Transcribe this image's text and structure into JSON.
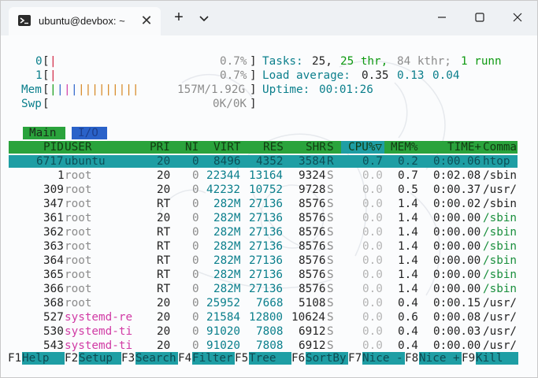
{
  "window": {
    "tab_title": "ubuntu@devbox: ~",
    "tab_icon": "terminal-icon",
    "new_tab_label": "+",
    "close_label": "✕"
  },
  "meters": {
    "cpu0": {
      "label": "0",
      "bar": "|",
      "value": "0.7%"
    },
    "cpu1": {
      "label": "1",
      "bar": "|",
      "value": "0.7%"
    },
    "mem": {
      "label": "Mem",
      "value": "157M/1.92G"
    },
    "swp": {
      "label": "Swp",
      "value": "0K/0K"
    }
  },
  "summary": {
    "tasks_label": "Tasks:",
    "tasks": "25,",
    "threads": "25 thr,",
    "kthr": "84 kthr;",
    "running": "1 runn",
    "load_label": "Load average:",
    "load1": "0.35",
    "load5": "0.13",
    "load15": "0.04",
    "uptime_label": "Uptime:",
    "uptime": "00:01:26"
  },
  "screen_tabs": {
    "main": "Main",
    "io": "I/O"
  },
  "columns": [
    "PID",
    "USER",
    "PRI",
    "NI",
    "VIRT",
    "RES",
    "SHR",
    "S",
    "CPU%▽",
    "MEM%",
    "TIME+",
    "Comma"
  ],
  "processes": [
    {
      "pid": "6717",
      "user": "ubuntu",
      "pri": "20",
      "ni": "0",
      "virt": "8496",
      "res": "4352",
      "shr": "3584",
      "s": "R",
      "cpu": "0.7",
      "mem": "0.2",
      "time": "0:00.06",
      "cmd": "htop"
    },
    {
      "pid": "1",
      "user": "root",
      "pri": "20",
      "ni": "0",
      "virt": "22344",
      "res": "13164",
      "shr": "9324",
      "s": "S",
      "cpu": "0.0",
      "mem": "0.7",
      "time": "0:02.08",
      "cmd": "/sbin"
    },
    {
      "pid": "309",
      "user": "root",
      "pri": "20",
      "ni": "0",
      "virt": "42232",
      "res": "10752",
      "shr": "9728",
      "s": "S",
      "cpu": "0.0",
      "mem": "0.5",
      "time": "0:00.37",
      "cmd": "/usr/"
    },
    {
      "pid": "347",
      "user": "root",
      "pri": "RT",
      "ni": "0",
      "virt": "282M",
      "res": "27136",
      "shr": "8576",
      "s": "S",
      "cpu": "0.0",
      "mem": "1.4",
      "time": "0:00.02",
      "cmd": "/sbin"
    },
    {
      "pid": "361",
      "user": "root",
      "pri": "20",
      "ni": "0",
      "virt": "282M",
      "res": "27136",
      "shr": "8576",
      "s": "S",
      "cpu": "0.0",
      "mem": "1.4",
      "time": "0:00.00",
      "cmd": "/sbin"
    },
    {
      "pid": "362",
      "user": "root",
      "pri": "RT",
      "ni": "0",
      "virt": "282M",
      "res": "27136",
      "shr": "8576",
      "s": "S",
      "cpu": "0.0",
      "mem": "1.4",
      "time": "0:00.00",
      "cmd": "/sbin"
    },
    {
      "pid": "363",
      "user": "root",
      "pri": "RT",
      "ni": "0",
      "virt": "282M",
      "res": "27136",
      "shr": "8576",
      "s": "S",
      "cpu": "0.0",
      "mem": "1.4",
      "time": "0:00.00",
      "cmd": "/sbin"
    },
    {
      "pid": "364",
      "user": "root",
      "pri": "RT",
      "ni": "0",
      "virt": "282M",
      "res": "27136",
      "shr": "8576",
      "s": "S",
      "cpu": "0.0",
      "mem": "1.4",
      "time": "0:00.00",
      "cmd": "/sbin"
    },
    {
      "pid": "365",
      "user": "root",
      "pri": "RT",
      "ni": "0",
      "virt": "282M",
      "res": "27136",
      "shr": "8576",
      "s": "S",
      "cpu": "0.0",
      "mem": "1.4",
      "time": "0:00.00",
      "cmd": "/sbin"
    },
    {
      "pid": "366",
      "user": "root",
      "pri": "RT",
      "ni": "0",
      "virt": "282M",
      "res": "27136",
      "shr": "8576",
      "s": "S",
      "cpu": "0.0",
      "mem": "1.4",
      "time": "0:00.00",
      "cmd": "/sbin"
    },
    {
      "pid": "368",
      "user": "root",
      "pri": "20",
      "ni": "0",
      "virt": "25952",
      "res": "7668",
      "shr": "5108",
      "s": "S",
      "cpu": "0.0",
      "mem": "0.4",
      "time": "0:00.15",
      "cmd": "/usr/"
    },
    {
      "pid": "527",
      "user": "systemd-re",
      "pri": "20",
      "ni": "0",
      "virt": "21584",
      "res": "12800",
      "shr": "10624",
      "s": "S",
      "cpu": "0.0",
      "mem": "0.6",
      "time": "0:00.08",
      "cmd": "/usr/"
    },
    {
      "pid": "530",
      "user": "systemd-ti",
      "pri": "20",
      "ni": "0",
      "virt": "91020",
      "res": "7808",
      "shr": "6912",
      "s": "S",
      "cpu": "0.0",
      "mem": "0.4",
      "time": "0:00.03",
      "cmd": "/usr/"
    },
    {
      "pid": "543",
      "user": "systemd-ti",
      "pri": "20",
      "ni": "0",
      "virt": "91020",
      "res": "7808",
      "shr": "6912",
      "s": "S",
      "cpu": "0.0",
      "mem": "0.4",
      "time": "0:00.00",
      "cmd": "/usr/"
    }
  ],
  "function_keys": [
    {
      "key": "F1",
      "label": "Help"
    },
    {
      "key": "F2",
      "label": "Setup"
    },
    {
      "key": "F3",
      "label": "Search"
    },
    {
      "key": "F4",
      "label": "Filter"
    },
    {
      "key": "F5",
      "label": "Tree"
    },
    {
      "key": "F6",
      "label": "SortBy"
    },
    {
      "key": "F7",
      "label": "Nice -"
    },
    {
      "key": "F8",
      "label": "Nice +"
    },
    {
      "key": "F9",
      "label": "Kill"
    }
  ],
  "colors": {
    "header_green": "#2aa33c",
    "selected_teal": "#1e9ea4",
    "io_blue": "#2a62c9",
    "user_magenta": "#d13ba5"
  }
}
